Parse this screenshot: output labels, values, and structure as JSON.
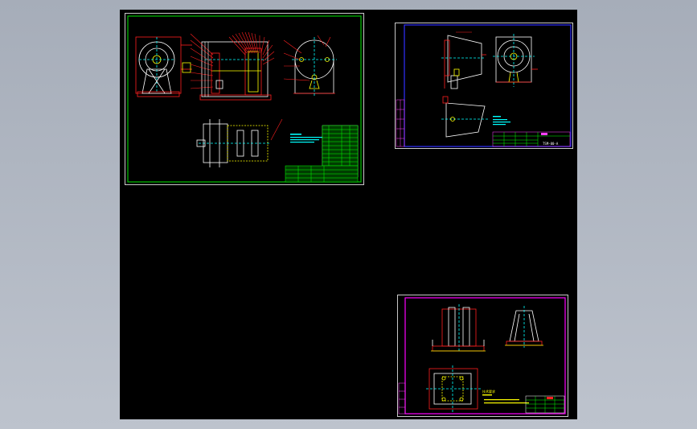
{
  "app": {
    "viewport_background": "#b4bac4",
    "canvas_background": "#000000"
  },
  "colors": {
    "border_green": "#00c000",
    "border_blue": "#3030ff",
    "border_magenta": "#ff00ff",
    "line_white": "#ffffff",
    "line_red": "#ff2020",
    "line_yellow": "#ffff00",
    "line_cyan": "#00ffff",
    "line_green": "#00ff00",
    "line_magenta": "#ff40ff"
  },
  "sheets": [
    {
      "id": "assembly-drawing",
      "border": "border_green"
    },
    {
      "id": "part-drawing-housing",
      "border": "border_blue"
    },
    {
      "id": "part-drawing-bracket",
      "border": "border_magenta"
    }
  ],
  "annotations": {
    "sheet2_title_block_code": "TSM-00-A",
    "sheet3_notes_heading": "技术要求"
  }
}
